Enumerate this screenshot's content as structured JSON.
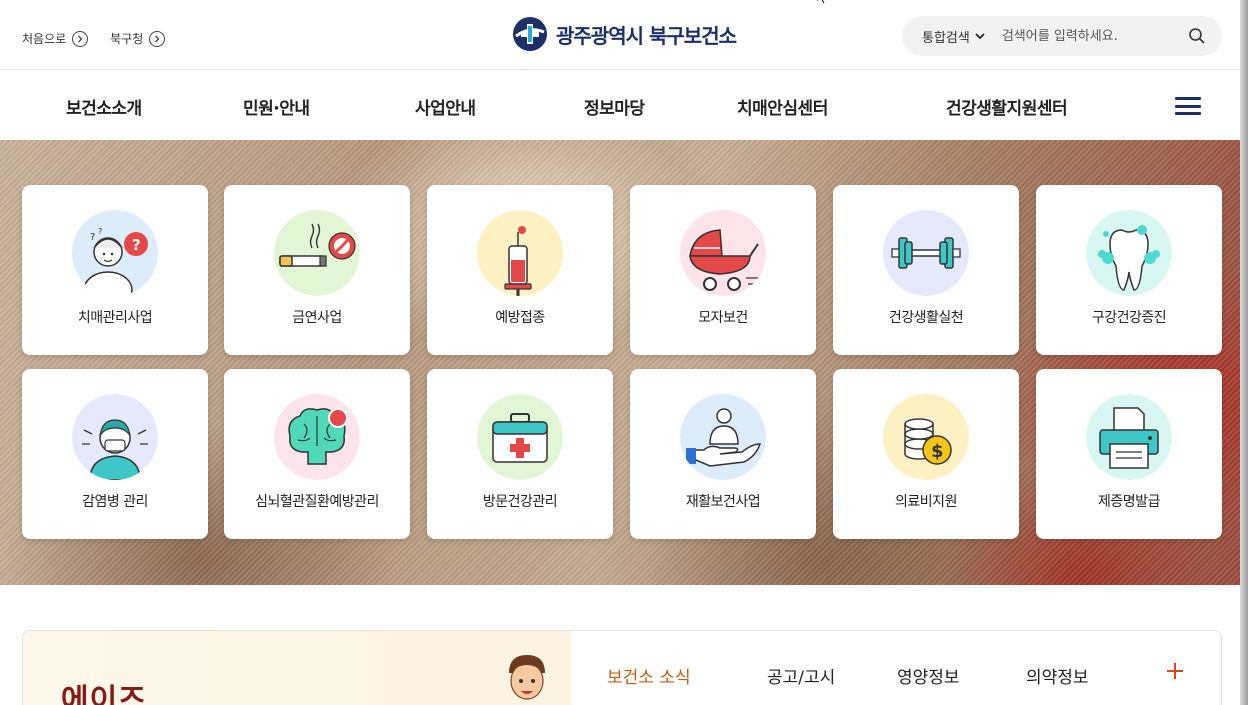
{
  "header": {
    "links": [
      {
        "label": "처음으로"
      },
      {
        "label": "북구청"
      }
    ],
    "logo": {
      "city": "광주광역시",
      "org": "북구보건소"
    },
    "search": {
      "scope": "통합검색",
      "placeholder": "검색어를 입력하세요."
    }
  },
  "nav": {
    "items": [
      "보건소소개",
      "민원·안내",
      "사업안내",
      "정보마당",
      "치매안심센터",
      "건강생활지원센터"
    ]
  },
  "services": [
    {
      "label": "치매관리사업",
      "icon": "dementia-icon",
      "bg": "#dcecfb"
    },
    {
      "label": "금연사업",
      "icon": "no-smoking-icon",
      "bg": "#e2f6d6"
    },
    {
      "label": "예방접종",
      "icon": "syringe-icon",
      "bg": "#fdf1c4"
    },
    {
      "label": "모자보건",
      "icon": "stroller-icon",
      "bg": "#fde3ea"
    },
    {
      "label": "건강생활실천",
      "icon": "dumbbell-icon",
      "bg": "#e6e8fb"
    },
    {
      "label": "구강건강증진",
      "icon": "tooth-icon",
      "bg": "#d8f7f3"
    },
    {
      "label": "감염병 관리",
      "icon": "masked-person-icon",
      "bg": "#e6e8fb"
    },
    {
      "label": "심뇌혈관질환예방관리",
      "icon": "brain-icon",
      "bg": "#fde3ea"
    },
    {
      "label": "방문건강관리",
      "icon": "medical-kit-icon",
      "bg": "#e2f6d6"
    },
    {
      "label": "재활보건사업",
      "icon": "hand-care-icon",
      "bg": "#dcecfb"
    },
    {
      "label": "의료비지원",
      "icon": "coins-icon",
      "bg": "#fdf1c4"
    },
    {
      "label": "제증명발급",
      "icon": "printer-icon",
      "bg": "#d8f7f3"
    }
  ],
  "news": {
    "banner_title": "에이즈",
    "tabs": [
      "보건소 소식",
      "공고/고시",
      "영양정보",
      "의약정보"
    ],
    "active_tab": "보건소 소식"
  },
  "colors": {
    "brand": "#1c2f6a",
    "accent": "#c75b10",
    "plus": "#d64a1a"
  }
}
